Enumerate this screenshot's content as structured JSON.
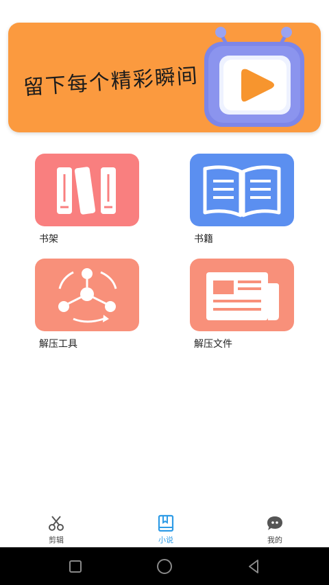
{
  "banner": {
    "slogan": "留下每个精彩瞬间",
    "background_color": "#fb9a3f",
    "art_icon": "tv-play-icon"
  },
  "grid": {
    "items": [
      {
        "label": "书架",
        "icon": "bookshelf-icon",
        "color": "#f97f7f"
      },
      {
        "label": "书籍",
        "icon": "open-book-icon",
        "color": "#5b8ff0"
      },
      {
        "label": "解压工具",
        "icon": "share-cycle-icon",
        "color": "#f8907a"
      },
      {
        "label": "解压文件",
        "icon": "newspaper-icon",
        "color": "#f8907a"
      }
    ]
  },
  "bottom_nav": {
    "items": [
      {
        "label": "剪辑",
        "icon": "scissors-icon",
        "active": false
      },
      {
        "label": "小说",
        "icon": "book-bookmark-icon",
        "active": true
      },
      {
        "label": "我的",
        "icon": "chat-bubble-face-icon",
        "active": false
      }
    ],
    "active_color": "#2e9be6"
  },
  "system_nav": {
    "buttons": [
      "recent-apps-icon",
      "home-icon",
      "back-icon"
    ]
  }
}
